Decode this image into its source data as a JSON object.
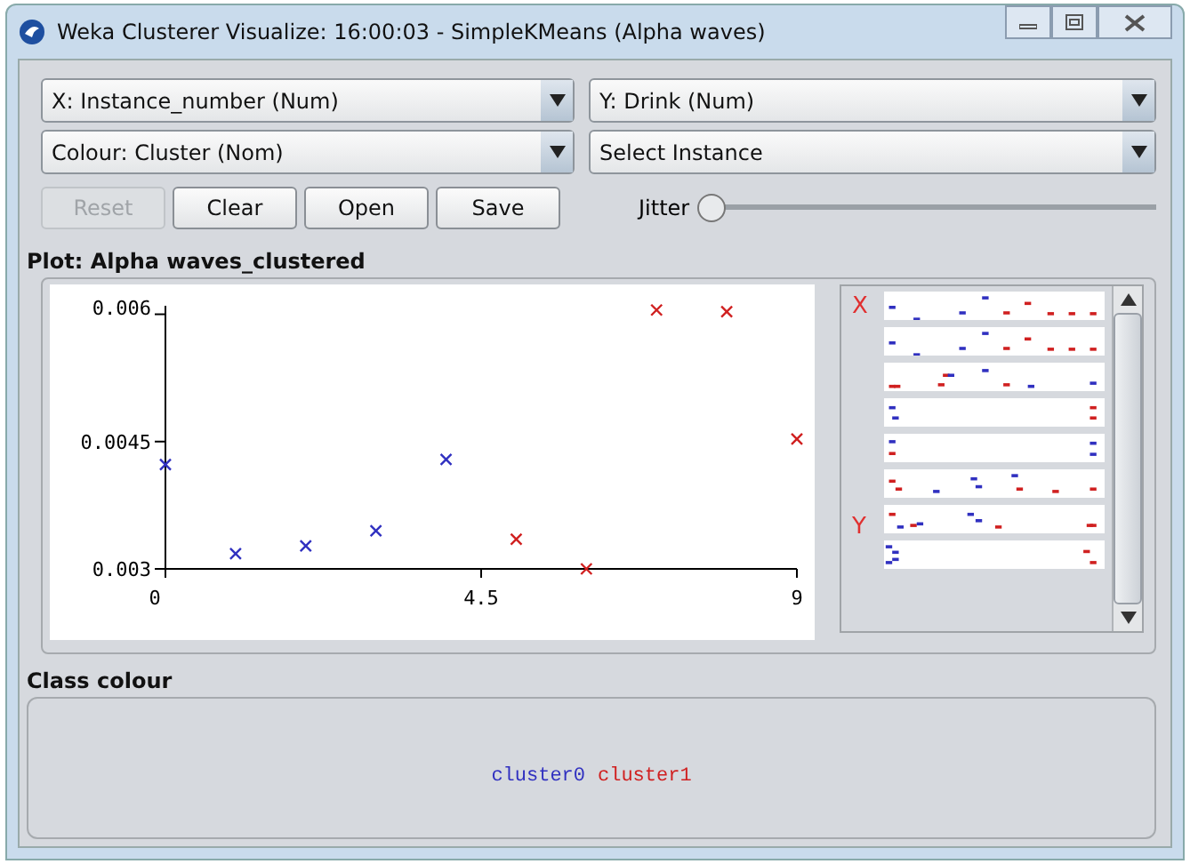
{
  "window": {
    "title": "Weka Clusterer Visualize: 16:00:03 - SimpleKMeans (Alpha waves)"
  },
  "selectors": [
    {
      "label": "X: Instance_number (Num)"
    },
    {
      "label": "Y: Drink (Num)"
    },
    {
      "label": "Colour: Cluster (Nom)"
    },
    {
      "label": "Select Instance"
    }
  ],
  "buttons": [
    {
      "label": "Reset",
      "disabled": true
    },
    {
      "label": "Clear",
      "disabled": false
    },
    {
      "label": "Open",
      "disabled": false
    },
    {
      "label": "Save",
      "disabled": false
    }
  ],
  "jitter": {
    "label": "Jitter",
    "level": 0
  },
  "plot": {
    "title": "Plot: Alpha waves_clustered",
    "chart_data": {
      "type": "scatter",
      "x": [
        0,
        1,
        2,
        3,
        4,
        5,
        6,
        7,
        8,
        9
      ],
      "series": [
        {
          "name": "cluster0",
          "color": "#3030c0",
          "values": [
            0.00423,
            0.00318,
            0.00327,
            0.00345,
            0.00429,
            null,
            null,
            null,
            null,
            null
          ]
        },
        {
          "name": "cluster1",
          "color": "#d02020",
          "values": [
            null,
            null,
            null,
            null,
            null,
            0.00335,
            0.003,
            0.00605,
            0.00603,
            0.00453
          ]
        }
      ],
      "xlim": [
        0,
        9
      ],
      "ylim": [
        0.003,
        0.0061
      ],
      "xticks": [
        0,
        4.5,
        9
      ],
      "yticks": [
        0.003,
        0.0045,
        0.006
      ]
    }
  },
  "attribute_panel": {
    "x_marker": "X",
    "y_marker": "Y"
  },
  "class_colour": {
    "title": "Class colour"
  }
}
